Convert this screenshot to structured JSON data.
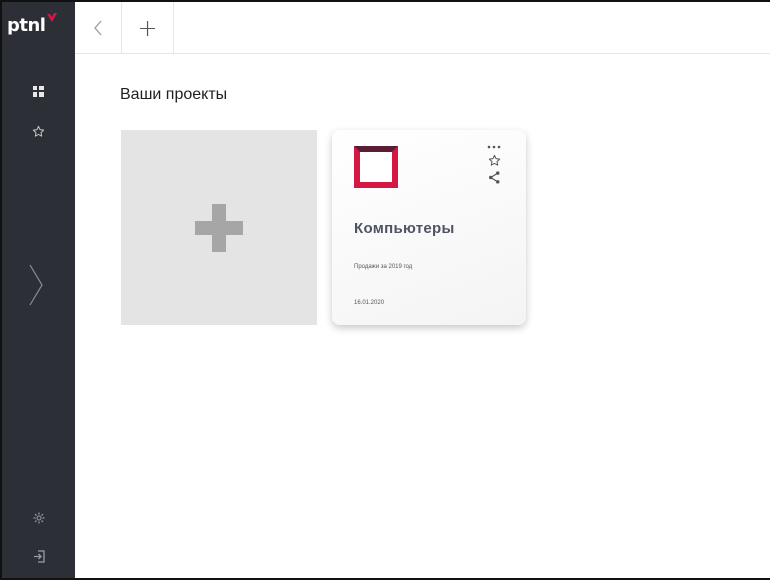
{
  "app": {
    "logo_text": "ptnl",
    "accent_color": "#d41743",
    "sidebar_color": "#2c2f36"
  },
  "sidebar": {
    "items": [
      {
        "icon": "dashboard-grid-icon"
      },
      {
        "icon": "star-icon"
      }
    ],
    "expand_icon": "chevron-right-icon",
    "bottom_items": [
      {
        "icon": "gear-icon"
      },
      {
        "icon": "logout-icon"
      }
    ]
  },
  "topbar": {
    "back_icon": "chevron-left-icon",
    "add_label": "+"
  },
  "main": {
    "title": "Ваши проекты",
    "new_project_icon": "plus-icon",
    "projects": [
      {
        "name": "Компьютеры",
        "description": "Продажи за 2019 год",
        "date": "16.01.2020",
        "menu_icon": "more-dots-icon",
        "favorite_icon": "star-icon",
        "share_icon": "share-icon"
      }
    ]
  }
}
